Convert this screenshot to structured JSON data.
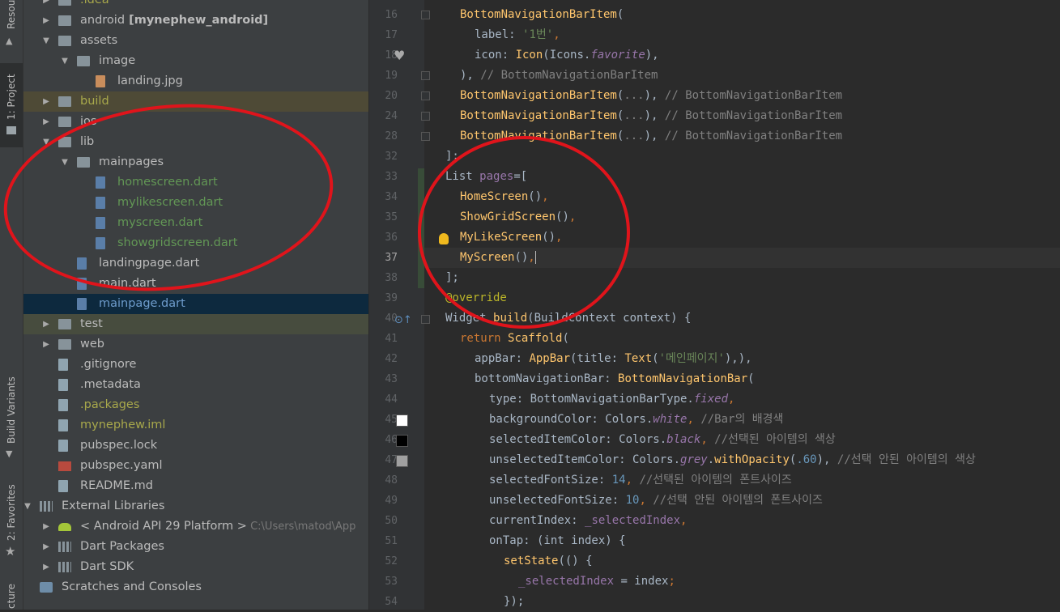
{
  "left_toolbar": {
    "tabs": [
      "Resou",
      "1: Project",
      "Build Variants",
      "2: Favorites",
      "cture"
    ]
  },
  "project_tree": [
    {
      "label": ".idea",
      "indent": 0,
      "kind": "folder",
      "arrow": "right",
      "color": "#a8a84b"
    },
    {
      "label": "android",
      "bold": "[mynephew_android]",
      "indent": 0,
      "kind": "folder",
      "arrow": "right"
    },
    {
      "label": "assets",
      "indent": 0,
      "kind": "folder",
      "arrow": "down"
    },
    {
      "label": "image",
      "indent": 1,
      "kind": "folder",
      "arrow": "down"
    },
    {
      "label": "landing.jpg",
      "indent": 2,
      "kind": "image"
    },
    {
      "label": "build",
      "indent": 0,
      "kind": "folder",
      "arrow": "right",
      "color": "#a8a84b",
      "hl": "yellow"
    },
    {
      "label": "ios",
      "indent": 0,
      "kind": "folder",
      "arrow": "right"
    },
    {
      "label": "lib",
      "indent": 0,
      "kind": "folder",
      "arrow": "down"
    },
    {
      "label": "mainpages",
      "indent": 1,
      "kind": "folder",
      "arrow": "down"
    },
    {
      "label": "homescreen.dart",
      "indent": 2,
      "kind": "dart",
      "color": "#629755"
    },
    {
      "label": "mylikescreen.dart",
      "indent": 2,
      "kind": "dart",
      "color": "#629755"
    },
    {
      "label": "myscreen.dart",
      "indent": 2,
      "kind": "dart",
      "color": "#629755"
    },
    {
      "label": "showgridscreen.dart",
      "indent": 2,
      "kind": "dart",
      "color": "#629755"
    },
    {
      "label": "landingpage.dart",
      "indent": 1,
      "kind": "dart"
    },
    {
      "label": "main.dart",
      "indent": 1,
      "kind": "dart"
    },
    {
      "label": "mainpage.dart",
      "indent": 1,
      "kind": "dart",
      "hl": "sel",
      "color": "#6e9ccc"
    },
    {
      "label": "test",
      "indent": 0,
      "kind": "folder",
      "arrow": "right",
      "hl": "gray"
    },
    {
      "label": "web",
      "indent": 0,
      "kind": "folder",
      "arrow": "right"
    },
    {
      "label": ".gitignore",
      "indent": 0,
      "kind": "file"
    },
    {
      "label": ".metadata",
      "indent": 0,
      "kind": "file"
    },
    {
      "label": ".packages",
      "indent": 0,
      "kind": "file",
      "color": "#a8a84b"
    },
    {
      "label": "mynephew.iml",
      "indent": 0,
      "kind": "file",
      "color": "#a8a84b"
    },
    {
      "label": "pubspec.lock",
      "indent": 0,
      "kind": "file"
    },
    {
      "label": "pubspec.yaml",
      "indent": 0,
      "kind": "yaml"
    },
    {
      "label": "README.md",
      "indent": 0,
      "kind": "file"
    },
    {
      "label": "External Libraries",
      "indent": -1,
      "kind": "lib",
      "arrow": "down"
    },
    {
      "label": "< Android API 29 Platform >",
      "extra": "C:\\Users\\matod\\App",
      "indent": 0,
      "kind": "android",
      "arrow": "right"
    },
    {
      "label": "Dart Packages",
      "indent": 0,
      "kind": "lib",
      "arrow": "right"
    },
    {
      "label": "Dart SDK",
      "indent": 0,
      "kind": "lib",
      "arrow": "right"
    },
    {
      "label": "Scratches and Consoles",
      "indent": -1,
      "kind": "scratch"
    }
  ],
  "editor": {
    "current_line": "37",
    "lines": [
      {
        "n": "16",
        "ind": 1,
        "t": [
          [
            "f",
            "BottomNavigationBarItem"
          ],
          [
            "",
            "("
          ]
        ]
      },
      {
        "n": "17",
        "ind": 2,
        "t": [
          [
            "",
            "label: "
          ],
          [
            "s",
            "'1번'"
          ],
          [
            "k",
            ","
          ]
        ]
      },
      {
        "n": "18",
        "ind": 2,
        "t": [
          [
            "",
            "icon: "
          ],
          [
            "f",
            "Icon"
          ],
          [
            "",
            "(Icons."
          ],
          [
            "pi",
            "favorite"
          ],
          [
            "",
            "),"
          ]
        ]
      },
      {
        "n": "19",
        "ind": 1,
        "t": [
          [
            "",
            "), "
          ],
          [
            "c",
            "// BottomNavigationBarItem"
          ]
        ]
      },
      {
        "n": "20",
        "ind": 1,
        "t": [
          [
            "f",
            "BottomNavigationBarItem"
          ],
          [
            "",
            "("
          ],
          [
            "c",
            "..."
          ],
          [
            "",
            "), "
          ],
          [
            "c",
            "// BottomNavigationBarItem"
          ]
        ]
      },
      {
        "n": "24",
        "ind": 1,
        "t": [
          [
            "f",
            "BottomNavigationBarItem"
          ],
          [
            "",
            "("
          ],
          [
            "c",
            "..."
          ],
          [
            "",
            "), "
          ],
          [
            "c",
            "// BottomNavigationBarItem"
          ]
        ]
      },
      {
        "n": "28",
        "ind": 1,
        "t": [
          [
            "f",
            "BottomNavigationBarItem"
          ],
          [
            "",
            "("
          ],
          [
            "c",
            "..."
          ],
          [
            "",
            "), "
          ],
          [
            "c",
            "// BottomNavigationBarItem"
          ]
        ]
      },
      {
        "n": "32",
        "ind": 0,
        "t": [
          [
            "",
            "];"
          ]
        ]
      },
      {
        "n": "33",
        "ind": 0,
        "t": [
          [
            "",
            "List "
          ],
          [
            "p",
            "pages"
          ],
          [
            "",
            "=["
          ]
        ]
      },
      {
        "n": "34",
        "ind": 1,
        "t": [
          [
            "f",
            "HomeScreen"
          ],
          [
            "",
            "()"
          ],
          [
            "k",
            ","
          ]
        ]
      },
      {
        "n": "35",
        "ind": 1,
        "t": [
          [
            "f",
            "ShowGridScreen"
          ],
          [
            "",
            "()"
          ],
          [
            "k",
            ","
          ]
        ]
      },
      {
        "n": "36",
        "ind": 1,
        "t": [
          [
            "f",
            "MyLikeScreen"
          ],
          [
            "",
            "()"
          ],
          [
            "k",
            ","
          ]
        ]
      },
      {
        "n": "37",
        "ind": 1,
        "t": [
          [
            "f",
            "MyScreen"
          ],
          [
            "",
            "()"
          ],
          [
            "k",
            ","
          ]
        ]
      },
      {
        "n": "38",
        "ind": 0,
        "t": [
          [
            "",
            "];"
          ]
        ]
      },
      {
        "n": "39",
        "ind": 0,
        "t": [
          [
            "ann",
            "@override"
          ]
        ]
      },
      {
        "n": "40",
        "ind": 0,
        "t": [
          [
            "",
            "Widget "
          ],
          [
            "f",
            "build"
          ],
          [
            "",
            "(BuildContext context) {"
          ]
        ]
      },
      {
        "n": "41",
        "ind": 1,
        "t": [
          [
            "k",
            "return "
          ],
          [
            "f",
            "Scaffold"
          ],
          [
            "",
            "("
          ]
        ]
      },
      {
        "n": "42",
        "ind": 2,
        "t": [
          [
            "",
            "appBar: "
          ],
          [
            "f",
            "AppBar"
          ],
          [
            "",
            "(title: "
          ],
          [
            "f",
            "Text"
          ],
          [
            "",
            "("
          ],
          [
            "s",
            "'메인페이지'"
          ],
          [
            "",
            "),),"
          ]
        ]
      },
      {
        "n": "43",
        "ind": 2,
        "t": [
          [
            "",
            "bottomNavigationBar: "
          ],
          [
            "f",
            "BottomNavigationBar"
          ],
          [
            "",
            "("
          ]
        ]
      },
      {
        "n": "44",
        "ind": 3,
        "t": [
          [
            "",
            "type: BottomNavigationBarType."
          ],
          [
            "pi",
            "fixed"
          ],
          [
            "k",
            ","
          ]
        ]
      },
      {
        "n": "45",
        "ind": 3,
        "t": [
          [
            "",
            "backgroundColor: Colors."
          ],
          [
            "pi",
            "white"
          ],
          [
            "k",
            ", "
          ],
          [
            "c",
            "//Bar의 배경색"
          ]
        ]
      },
      {
        "n": "46",
        "ind": 3,
        "t": [
          [
            "",
            "selectedItemColor: Colors."
          ],
          [
            "pi",
            "black"
          ],
          [
            "k",
            ", "
          ],
          [
            "c",
            "//선택된 아이템의 색상"
          ]
        ]
      },
      {
        "n": "47",
        "ind": 3,
        "t": [
          [
            "",
            "unselectedItemColor: Colors."
          ],
          [
            "pi",
            "grey"
          ],
          [
            "",
            "."
          ],
          [
            "f",
            "withOpacity"
          ],
          [
            "",
            "("
          ],
          [
            "n",
            ".60"
          ],
          [
            "",
            "), "
          ],
          [
            "c",
            "//선택 안된 아이템의 색상"
          ]
        ]
      },
      {
        "n": "48",
        "ind": 3,
        "t": [
          [
            "",
            "selectedFontSize: "
          ],
          [
            "n",
            "14"
          ],
          [
            "k",
            ", "
          ],
          [
            "c",
            "//선택된 아이템의 폰트사이즈"
          ]
        ]
      },
      {
        "n": "49",
        "ind": 3,
        "t": [
          [
            "",
            "unselectedFontSize: "
          ],
          [
            "n",
            "10"
          ],
          [
            "k",
            ", "
          ],
          [
            "c",
            "//선택 안된 아이템의 폰트사이즈"
          ]
        ]
      },
      {
        "n": "50",
        "ind": 3,
        "t": [
          [
            "",
            "currentIndex: "
          ],
          [
            "p",
            "_selectedIndex"
          ],
          [
            "k",
            ","
          ]
        ]
      },
      {
        "n": "51",
        "ind": 3,
        "t": [
          [
            "",
            "onTap: (int index) {"
          ]
        ]
      },
      {
        "n": "52",
        "ind": 4,
        "t": [
          [
            "f",
            "setState"
          ],
          [
            "",
            "(() {"
          ]
        ]
      },
      {
        "n": "53",
        "ind": 5,
        "t": [
          [
            "p",
            "_selectedIndex"
          ],
          [
            "",
            " = index"
          ],
          [
            "k",
            ";"
          ]
        ]
      },
      {
        "n": "54",
        "ind": 4,
        "t": [
          [
            "",
            "});"
          ]
        ]
      }
    ]
  },
  "colors": {
    "swatch_45": "#ffffff",
    "swatch_46": "#000000",
    "swatch_47": "#a0a0a0",
    "annotation_red": "#e0141b"
  }
}
